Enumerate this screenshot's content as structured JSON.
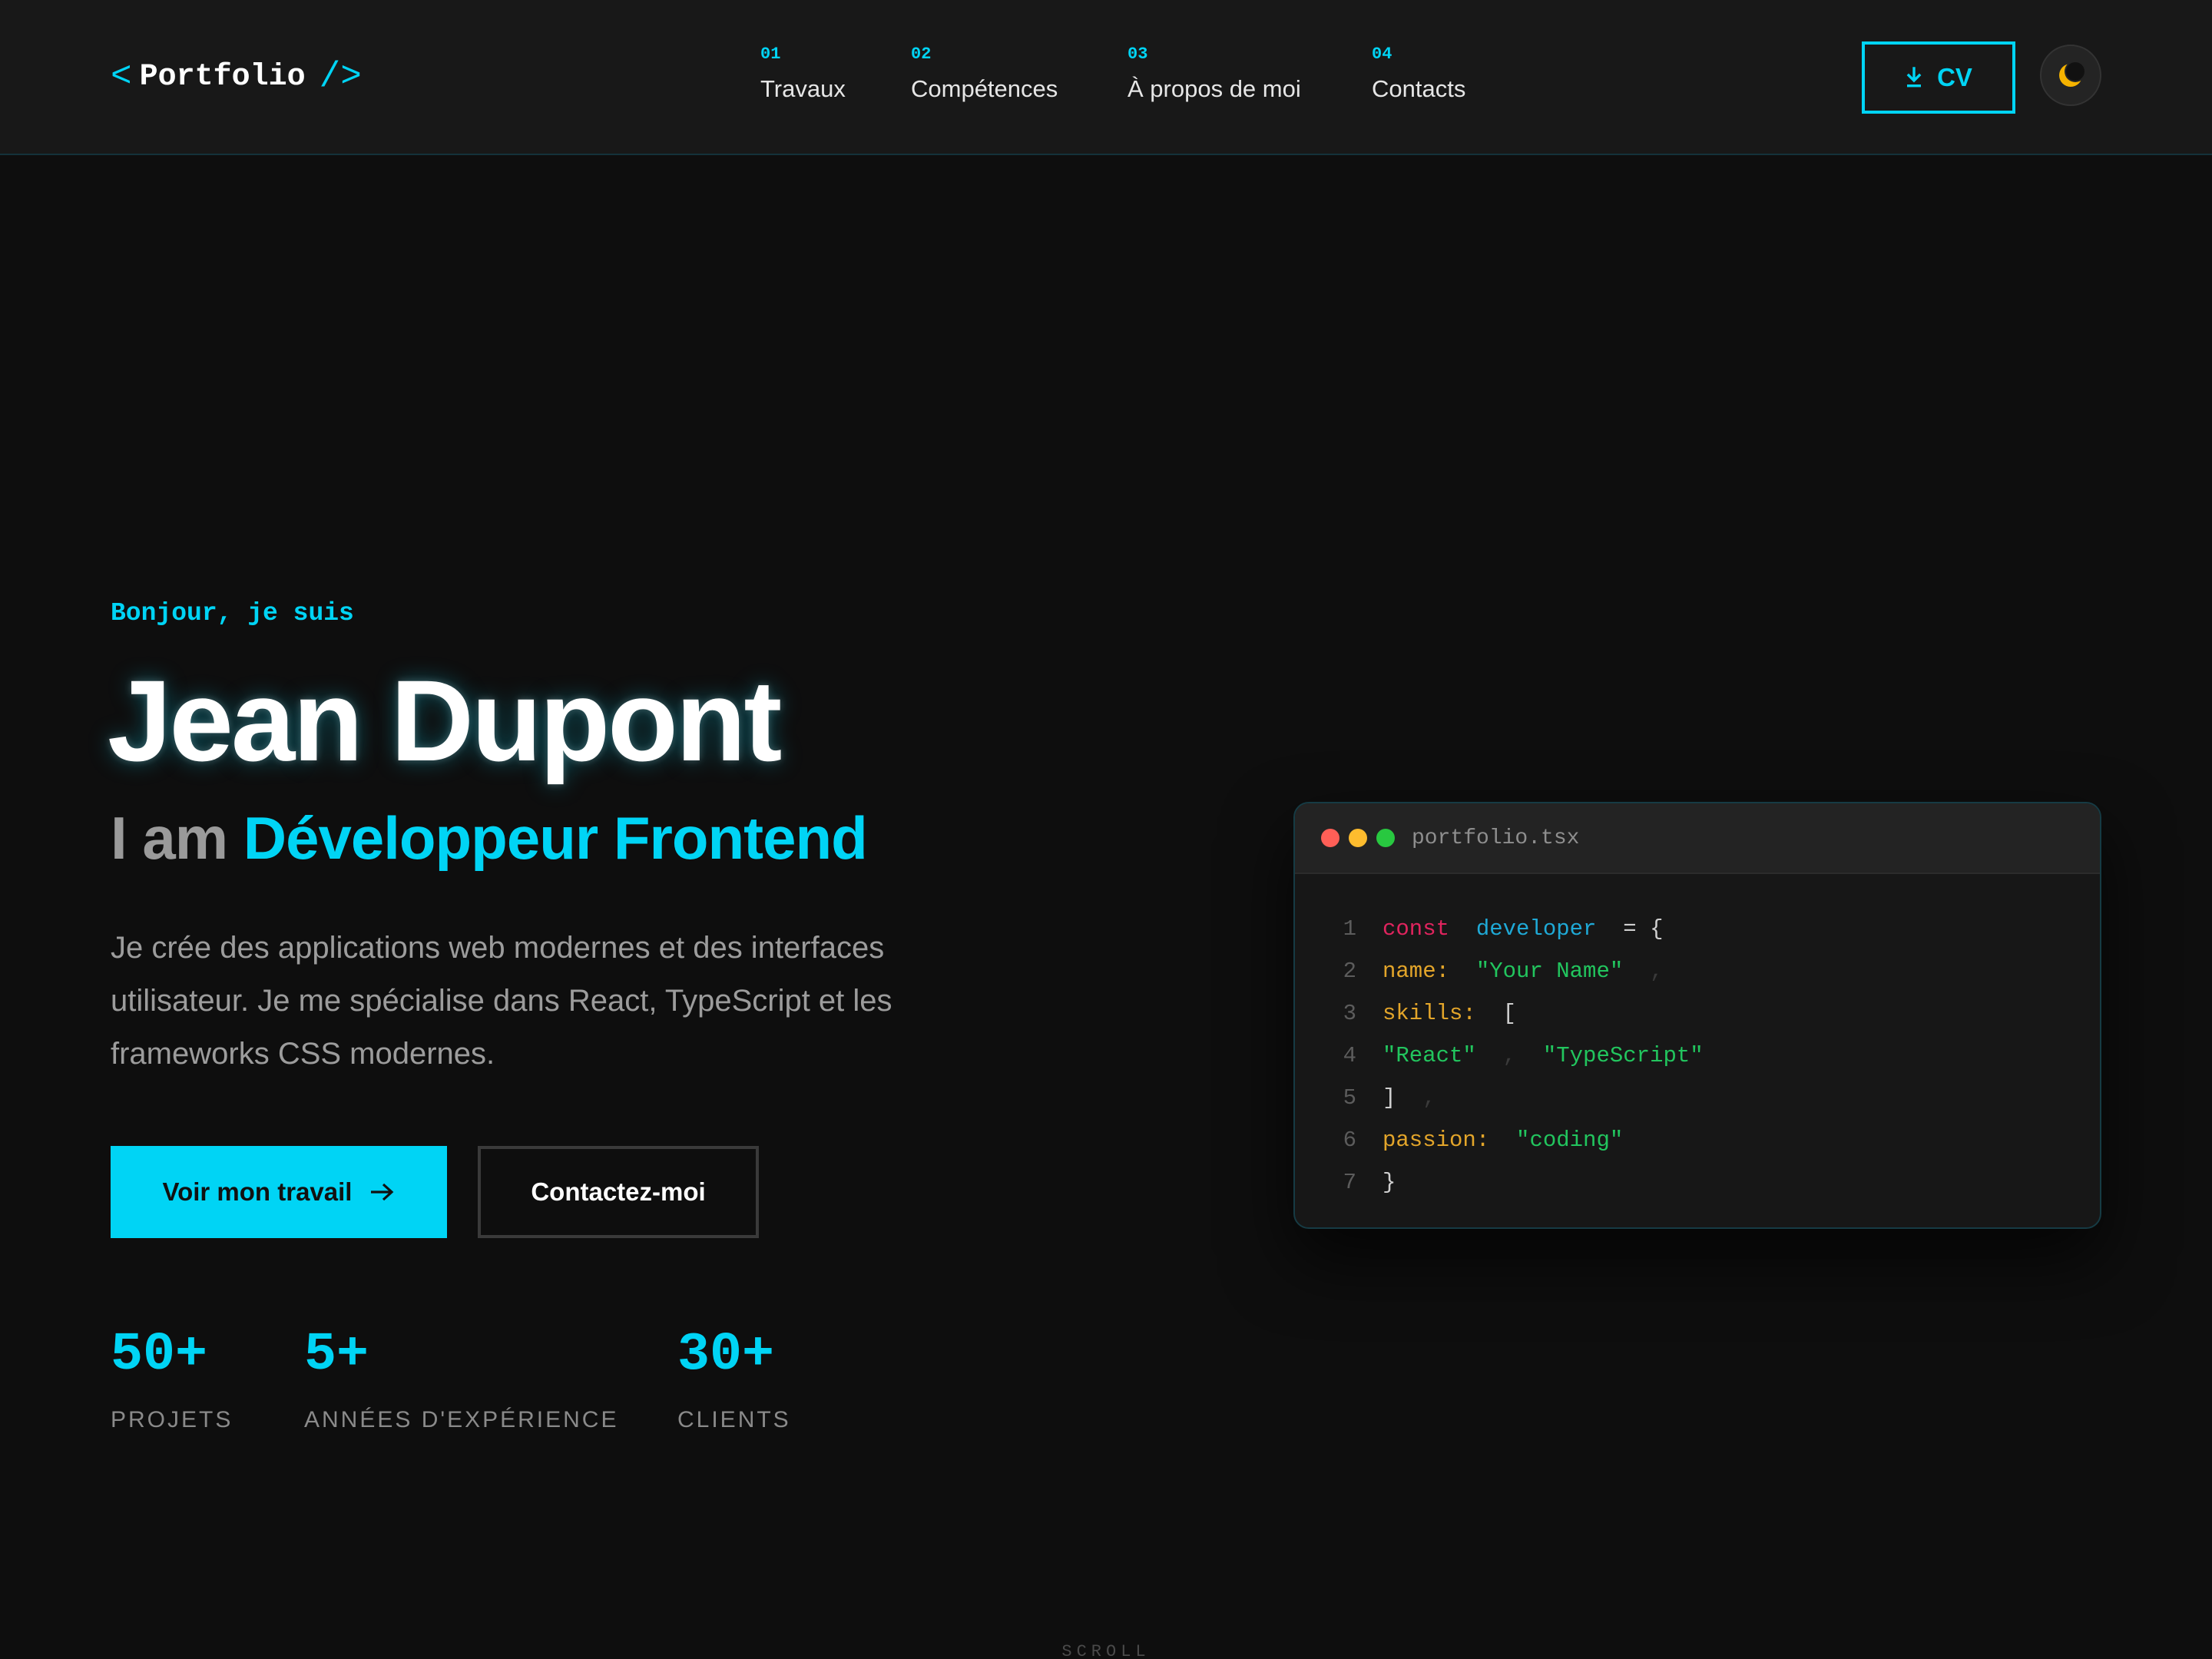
{
  "header": {
    "logo_open": "<",
    "logo_text": "Portfolio",
    "logo_close": "/>",
    "nav": [
      {
        "num": "01",
        "label": "Travaux"
      },
      {
        "num": "02",
        "label": "Compétences"
      },
      {
        "num": "03",
        "label": "À propos de moi"
      },
      {
        "num": "04",
        "label": "Contacts"
      }
    ],
    "cv_label": "CV",
    "cv_icon": "download-icon",
    "theme_icon": "moon-icon"
  },
  "hero": {
    "greeting": "Bonjour, je suis",
    "name": "Jean Dupont",
    "role_prefix": "I am",
    "role_highlight": "Développeur Frontend",
    "description": "Je crée des applications web modernes et des interfaces utilisateur. Je me spécialise dans React, TypeScript et les frameworks CSS modernes.",
    "primary_button": "Voir mon travail",
    "secondary_button": "Contactez-moi",
    "stats": [
      {
        "value": "50+",
        "label": "PROJETS"
      },
      {
        "value": "5+",
        "label": "ANNÉES D'EXPÉRIENCE"
      },
      {
        "value": "30+",
        "label": "CLIENTS"
      }
    ]
  },
  "code_window": {
    "filename": "portfolio.tsx",
    "lines": [
      {
        "n": "1",
        "tokens": [
          [
            "kw",
            "const"
          ],
          [
            "punc",
            "  "
          ],
          [
            "id",
            "developer"
          ],
          [
            "punc",
            "  = {"
          ]
        ]
      },
      {
        "n": "2",
        "tokens": [
          [
            "prop",
            "name:"
          ],
          [
            "punc",
            "  "
          ],
          [
            "str",
            "\"Your Name\""
          ],
          [
            "faint",
            "  ,"
          ]
        ]
      },
      {
        "n": "3",
        "tokens": [
          [
            "prop",
            "skills:"
          ],
          [
            "punc",
            "  ["
          ]
        ]
      },
      {
        "n": "4",
        "tokens": [
          [
            "str",
            "\"React\""
          ],
          [
            "faint",
            "  ,  "
          ],
          [
            "str",
            "\"TypeScript\""
          ]
        ]
      },
      {
        "n": "5",
        "tokens": [
          [
            "punc",
            "]"
          ],
          [
            "faint",
            "  ,"
          ]
        ]
      },
      {
        "n": "6",
        "tokens": [
          [
            "prop",
            "passion:"
          ],
          [
            "punc",
            "  "
          ],
          [
            "str",
            "\"coding\""
          ]
        ]
      },
      {
        "n": "7",
        "tokens": [
          [
            "punc",
            "}"
          ]
        ]
      }
    ]
  },
  "scroll_label": "SCROLL",
  "colors": {
    "accent": "#00d4f5",
    "background": "#0e0e0e",
    "header": "#181818",
    "keyword": "#e0245e",
    "string": "#22c55e",
    "property": "#e3a52a"
  }
}
